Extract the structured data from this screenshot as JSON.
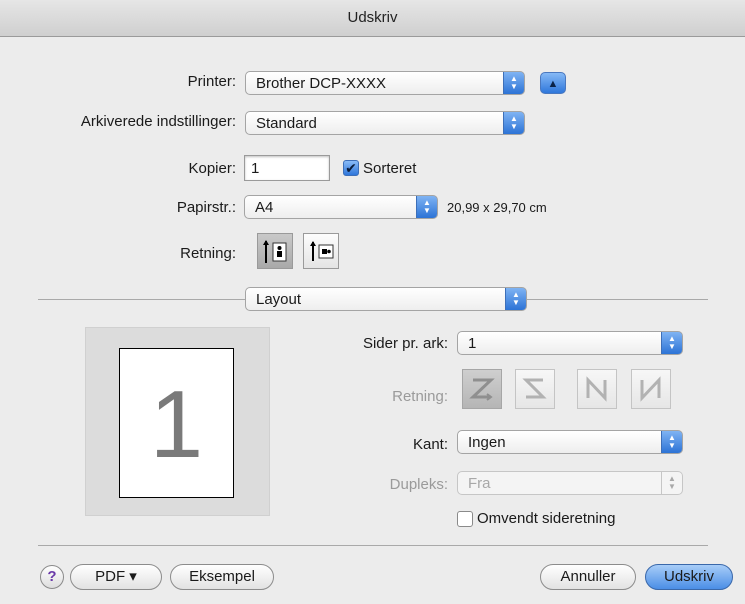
{
  "window": {
    "title": "Udskriv"
  },
  "printer": {
    "label": "Printer:",
    "value": "Brother DCP-XXXX"
  },
  "presets": {
    "label": "Arkiverede indstillinger:",
    "value": "Standard"
  },
  "copies": {
    "label": "Kopier:",
    "value": "1",
    "collate_label": "Sorteret",
    "collate_checked": true
  },
  "paper": {
    "label": "Papirstr.:",
    "value": "A4",
    "dimensions": "20,99 x 29,70 cm"
  },
  "orientation": {
    "label": "Retning:",
    "selected": "portrait"
  },
  "panel": {
    "value": "Layout"
  },
  "preview": {
    "page_number": "1"
  },
  "layout": {
    "pages_per_sheet_label": "Sider pr. ark:",
    "pages_per_sheet_value": "1",
    "direction_label": "Retning:",
    "border_label": "Kant:",
    "border_value": "Ingen",
    "duplex_label": "Dupleks:",
    "duplex_value": "Fra",
    "reverse_label": "Omvendt sideretning",
    "reverse_checked": false
  },
  "footer": {
    "help": "?",
    "pdf_label": "PDF ▾",
    "preview_label": "Eksempel",
    "cancel_label": "Annuller",
    "print_label": "Udskriv"
  },
  "colors": {
    "accent": "#2f77db",
    "help_icon": "#6a3aa8"
  }
}
